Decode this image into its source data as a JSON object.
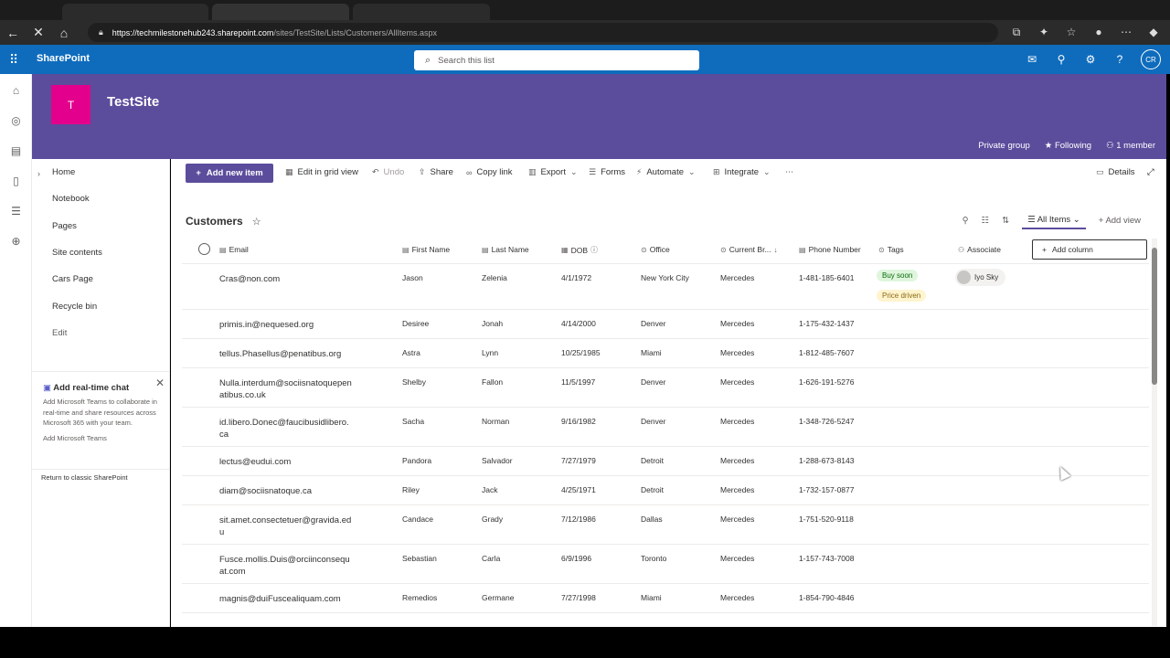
{
  "browser": {
    "url_host": "https://techmilestonehub243.sharepoint.com",
    "url_path": "/sites/TestSite/Lists/Customers/AllItems.aspx"
  },
  "suite": {
    "brand": "SharePoint",
    "search_placeholder": "Search this list",
    "avatar_initials": "CR"
  },
  "site": {
    "logo_letter": "T",
    "title": "TestSite",
    "group_type": "Private group",
    "following": "Following",
    "members": "1 member"
  },
  "nav": {
    "items": [
      "Home",
      "Notebook",
      "Pages",
      "Site contents",
      "Cars Page",
      "Recycle bin",
      "Edit"
    ],
    "teams_title": "Add real-time chat",
    "teams_desc": "Add Microsoft Teams to collaborate in real-time and share resources across Microsoft 365 with your team.",
    "teams_link": "Add Microsoft Teams",
    "classic": "Return to classic SharePoint"
  },
  "commands": {
    "new_item": "Add new item",
    "grid_view": "Edit in grid view",
    "undo": "Undo",
    "share": "Share",
    "copy_link": "Copy link",
    "export": "Export",
    "forms": "Forms",
    "automate": "Automate",
    "integrate": "Integrate",
    "details": "Details"
  },
  "list": {
    "title": "Customers",
    "view": "All Items",
    "add_view": "Add view",
    "add_column": "Add column",
    "columns": [
      "Email",
      "First Name",
      "Last Name",
      "DOB",
      "Office",
      "Current Br...",
      "Phone Number",
      "Tags",
      "Associate"
    ],
    "rows": [
      {
        "email": "Cras@non.com",
        "first": "Jason",
        "last": "Zelenia",
        "dob": "4/1/1972",
        "office": "New York City",
        "brand": "Mercedes",
        "phone": "1-481-185-6401",
        "tags": [
          "Buy soon",
          "Price driven"
        ],
        "associate": "Iyo Sky"
      },
      {
        "email": "primis.in@nequesed.org",
        "first": "Desiree",
        "last": "Jonah",
        "dob": "4/14/2000",
        "office": "Denver",
        "brand": "Mercedes",
        "phone": "1-175-432-1437"
      },
      {
        "email": "tellus.Phasellus@penatibus.org",
        "first": "Astra",
        "last": "Lynn",
        "dob": "10/25/1985",
        "office": "Miami",
        "brand": "Mercedes",
        "phone": "1-812-485-7607"
      },
      {
        "email": "Nulla.interdum@sociisnatoquepenatibus.co.uk",
        "first": "Shelby",
        "last": "Fallon",
        "dob": "11/5/1997",
        "office": "Denver",
        "brand": "Mercedes",
        "phone": "1-626-191-5276"
      },
      {
        "email": "id.libero.Donec@faucibusidlibero.ca",
        "first": "Sacha",
        "last": "Norman",
        "dob": "9/16/1982",
        "office": "Denver",
        "brand": "Mercedes",
        "phone": "1-348-726-5247"
      },
      {
        "email": "lectus@eudui.com",
        "first": "Pandora",
        "last": "Salvador",
        "dob": "7/27/1979",
        "office": "Detroit",
        "brand": "Mercedes",
        "phone": "1-288-673-8143"
      },
      {
        "email": "diam@sociisnatoque.ca",
        "first": "Riley",
        "last": "Jack",
        "dob": "4/25/1971",
        "office": "Detroit",
        "brand": "Mercedes",
        "phone": "1-732-157-0877"
      },
      {
        "email": "sit.amet.consectetuer@gravida.edu",
        "first": "Candace",
        "last": "Grady",
        "dob": "7/12/1986",
        "office": "Dallas",
        "brand": "Mercedes",
        "phone": "1-751-520-9118"
      },
      {
        "email": "Fusce.mollis.Duis@orciinconsequat.com",
        "first": "Sebastian",
        "last": "Carla",
        "dob": "6/9/1996",
        "office": "Toronto",
        "brand": "Mercedes",
        "phone": "1-157-743-7008"
      },
      {
        "email": "magnis@duiFuscealiquam.com",
        "first": "Remedios",
        "last": "Germane",
        "dob": "7/27/1998",
        "office": "Miami",
        "brand": "Mercedes",
        "phone": "1-854-790-4846"
      }
    ]
  }
}
